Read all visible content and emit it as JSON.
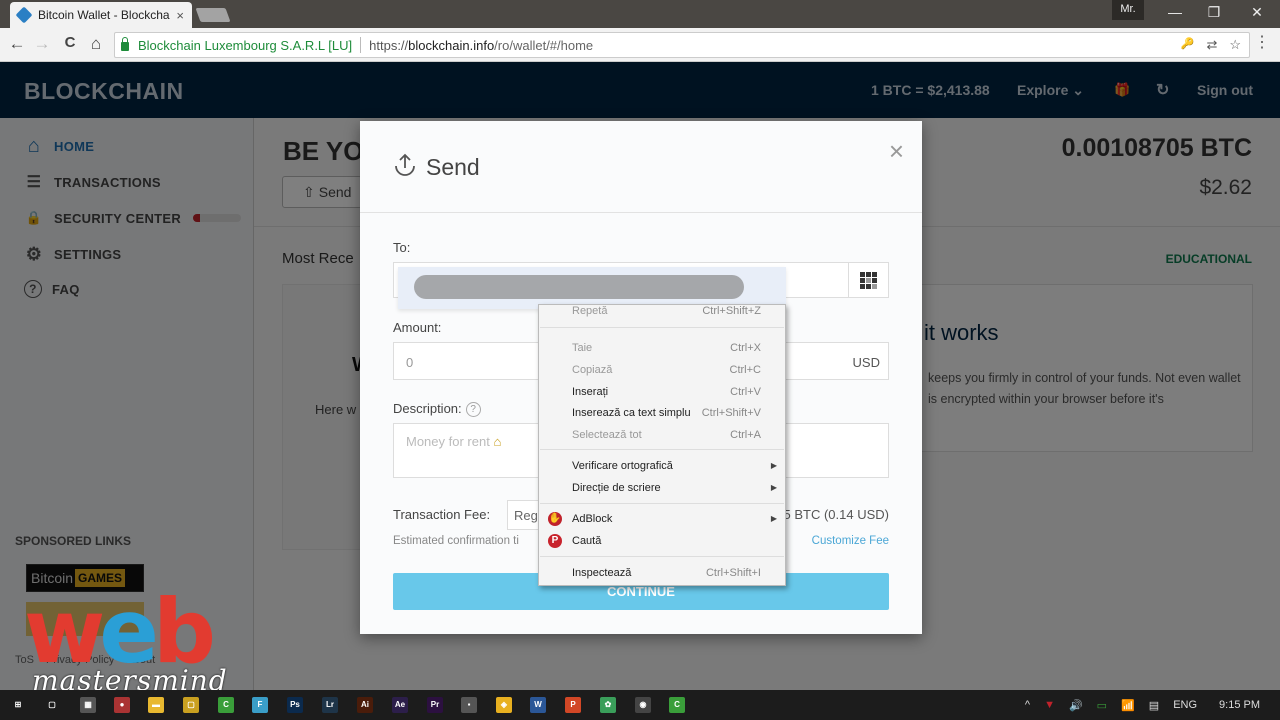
{
  "browser": {
    "tab_title": "Bitcoin Wallet - Blockcha",
    "tab_close": "×",
    "profile": "Mr.",
    "window_controls": {
      "minimize": "—",
      "restore": "❐",
      "close": "✕"
    },
    "nav": {
      "back": "←",
      "forward": "→",
      "reload": "C",
      "home": "⌂"
    },
    "ev_name": "Blockchain Luxembourg S.A.R.L [LU]",
    "url_scheme": "https://",
    "url_host": "blockchain.info",
    "url_path": "/ro/wallet/#/home",
    "toolbar_icons": {
      "key": "🔑",
      "translate": "⇄",
      "star": "☆",
      "menu": "⋮"
    }
  },
  "header": {
    "logo": "BLOCKCHAIN",
    "rate": "1 BTC = $2,413.88",
    "explore": "Explore ⌄",
    "gift": "🎁",
    "refresh": "↻",
    "sign_out": "Sign out"
  },
  "sidebar": {
    "items": [
      {
        "label": "HOME",
        "icon": "home-icon",
        "glyph": "⌂",
        "active": true
      },
      {
        "label": "TRANSACTIONS",
        "icon": "transactions-icon",
        "glyph": "☰",
        "active": false
      },
      {
        "label": "SECURITY CENTER",
        "icon": "lock-icon",
        "glyph": "🔒",
        "active": false
      },
      {
        "label": "SETTINGS",
        "icon": "gear-icon",
        "glyph": "⚙",
        "active": false
      },
      {
        "label": "FAQ",
        "icon": "question-icon",
        "glyph": "?",
        "active": false
      }
    ],
    "security_progress": 0.15,
    "sponsored_title": "SPONSORED LINKS",
    "ad_bitcoin": "Bitcoin",
    "ad_games": "GAMES",
    "footer_links": [
      "ToS",
      "Privacy Policy",
      "About"
    ]
  },
  "main": {
    "title": "BE YO",
    "send_button": "Send",
    "most_recent": "Most Rece",
    "recent_heading": "W",
    "recent_text": "Here w",
    "balance_btc": "0.00108705 BTC",
    "balance_usd": "$2.62",
    "educational": "EDUCATIONAL",
    "edu_title": "it works",
    "edu_text": "keeps you firmly in control of your funds. Not even wallet is encrypted within your browser before it's"
  },
  "modal": {
    "title": "Send",
    "close": "×",
    "to_label": "To:",
    "amount_label": "Amount:",
    "amount_value": "0",
    "amount_currency": "USD",
    "description_label": "Description:",
    "description_placeholder": "Money for rent",
    "fee_label": "Transaction Fee:",
    "fee_option": "Reg",
    "fee_amount": "5 BTC (0.14 USD)",
    "est_confirmation": "Estimated confirmation ti",
    "customize_fee": "Customize Fee",
    "continue": "CONTINUE"
  },
  "context_menu": {
    "items": [
      {
        "label": "Repetă",
        "shortcut": "Ctrl+Shift+Z",
        "disabled": true
      },
      {
        "label": "Taie",
        "shortcut": "Ctrl+X",
        "disabled": true
      },
      {
        "label": "Copiază",
        "shortcut": "Ctrl+C",
        "disabled": true
      },
      {
        "label": "Inserați",
        "shortcut": "Ctrl+V",
        "disabled": false
      },
      {
        "label": "Inserează ca text simplu",
        "shortcut": "Ctrl+Shift+V",
        "disabled": false
      },
      {
        "label": "Selectează tot",
        "shortcut": "Ctrl+A",
        "disabled": true
      },
      {
        "label": "Verificare ortografică",
        "submenu": true
      },
      {
        "label": "Direcție de scriere",
        "submenu": true
      },
      {
        "label": "AdBlock",
        "submenu": true,
        "icon": "adblock-icon"
      },
      {
        "label": "Caută",
        "icon": "pinterest-icon"
      },
      {
        "label": "Inspectează",
        "shortcut": "Ctrl+Shift+I",
        "disabled": false
      }
    ]
  },
  "watermark": {
    "w": "w",
    "e": "e",
    "b": "b",
    "sub": "mastersmind"
  },
  "taskbar": {
    "apps": [
      {
        "name": "start",
        "label": "⊞",
        "color": "#1c1c1c"
      },
      {
        "name": "task-view",
        "label": "▢",
        "color": "#1c1c1c"
      },
      {
        "name": "calculator",
        "label": "▦",
        "color": "#555"
      },
      {
        "name": "app-4",
        "label": "●",
        "color": "#a33"
      },
      {
        "name": "file-explorer",
        "label": "▬",
        "color": "#e8b830"
      },
      {
        "name": "app-6",
        "label": "▢",
        "color": "#c9a020"
      },
      {
        "name": "camtasia",
        "label": "C",
        "color": "#3a9e3a"
      },
      {
        "name": "app-8",
        "label": "F",
        "color": "#3a9ec8"
      },
      {
        "name": "photoshop",
        "label": "Ps",
        "color": "#0b2a4d"
      },
      {
        "name": "lightroom",
        "label": "Lr",
        "color": "#1e3448"
      },
      {
        "name": "illustrator",
        "label": "Ai",
        "color": "#4a1c0a"
      },
      {
        "name": "after-effects",
        "label": "Ae",
        "color": "#2c1e4a"
      },
      {
        "name": "premiere",
        "label": "Pr",
        "color": "#2c1040"
      },
      {
        "name": "app-14",
        "label": "▪",
        "color": "#555"
      },
      {
        "name": "app-15",
        "label": "◈",
        "color": "#e8b020"
      },
      {
        "name": "word",
        "label": "W",
        "color": "#2b5797"
      },
      {
        "name": "powerpoint",
        "label": "P",
        "color": "#d24726"
      },
      {
        "name": "app-18",
        "label": "✿",
        "color": "#3a9e5a"
      },
      {
        "name": "chrome",
        "label": "◉",
        "color": "#444"
      },
      {
        "name": "camtasia-2",
        "label": "C",
        "color": "#3a9e3a"
      }
    ],
    "tray": {
      "chevron": "^",
      "volume": "🔊",
      "wifi": "📶",
      "lang": "ENG",
      "time": "9:15 PM"
    }
  }
}
